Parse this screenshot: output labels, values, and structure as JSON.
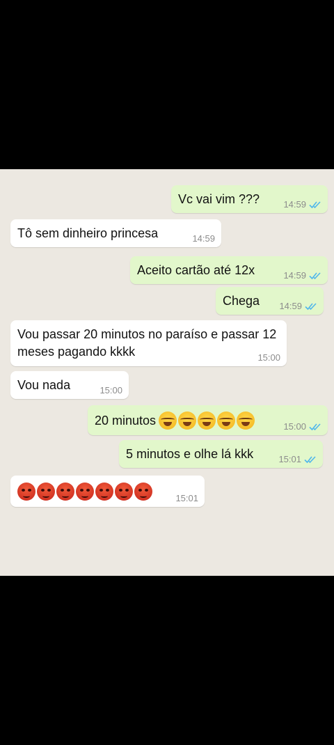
{
  "messages": [
    {
      "text": "Vc vai vim ???",
      "time": "14:59",
      "direction": "out",
      "status": "read"
    },
    {
      "text": "Tô sem dinheiro princesa",
      "time": "14:59",
      "direction": "in"
    },
    {
      "text": "Aceito cartão até 12x",
      "time": "14:59",
      "direction": "out",
      "status": "read"
    },
    {
      "text": "Chega",
      "time": "14:59",
      "direction": "out",
      "status": "read"
    },
    {
      "text": "Vou passar 20 minutos no paraíso e passar 12 meses pagando kkkk",
      "time": "15:00",
      "direction": "in"
    },
    {
      "text": "Vou nada",
      "time": "15:00",
      "direction": "in"
    },
    {
      "text": "20 minutos",
      "emoji": "😂😂😂😂😂",
      "time": "15:00",
      "direction": "out",
      "status": "read"
    },
    {
      "text": "5 minutos e olhe lá kkk",
      "time": "15:01",
      "direction": "out",
      "status": "read"
    },
    {
      "text": "😡😡😡😡😡😡😡",
      "time": "15:01",
      "direction": "in"
    }
  ],
  "colors": {
    "outgoing_bubble": "#e2f7cb",
    "incoming_bubble": "#ffffff",
    "chat_background": "#ece8e1",
    "read_ticks": "#4fb6ec"
  },
  "icons": {
    "read_receipt": "double-check-icon",
    "laugh_emoji": "tears-of-joy-emoji",
    "angry_emoji": "angry-face-emoji"
  }
}
